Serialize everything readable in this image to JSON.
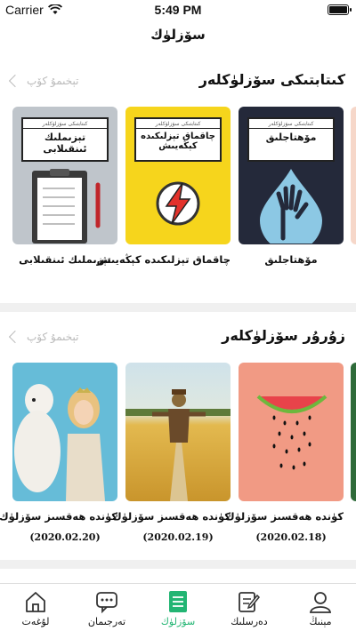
{
  "status": {
    "carrier": "Carrier",
    "time": "5:49 PM"
  },
  "nav": {
    "title": "سۆزلۈك"
  },
  "sections": [
    {
      "title": "كىتابتىكى سۆزلۈكلەر",
      "more": "تېخىمۇ كۆپ",
      "items": [
        {
          "title": "مۆھتاجلىق",
          "cover_title": "مۆھتاجلىق",
          "cover_small": "كىتابتىكى سۆزلۈكلەر"
        },
        {
          "title": "چاقماق تېزلىكىدە كېڭەيىش",
          "cover_title": "چاقماق تېزلىكىدە كېڭەيىش",
          "cover_small": "كىتابتىكى سۆزلۈكلەر"
        },
        {
          "title": "تېزىملىك ئىنقىلابى",
          "cover_title": "تېزىملىك ئىنقىلابى",
          "cover_small": "كىتابتىكى سۆزلۈكلەر"
        }
      ]
    },
    {
      "title": "زۇرۇر سۆزلۈكلەر",
      "more": "تېخىمۇ كۆپ",
      "items": [
        {
          "title": "كۈندە ھەقسىز سۆزلۈك",
          "date": "(2020.02.18)"
        },
        {
          "title": "كۈندە ھەقسىز سۆزلۈك",
          "date": "(2020.02.19)"
        },
        {
          "title": "كۈندە ھەقسىز سۆزلۈك",
          "date": "(2020.02.20)"
        }
      ]
    }
  ],
  "tabs": [
    {
      "label": "مېنىڭ",
      "icon": "person-icon"
    },
    {
      "label": "دەرسلىك",
      "icon": "pencil-paper-icon"
    },
    {
      "label": "سۆزلۈك",
      "icon": "vocabulary-list-icon",
      "active": true
    },
    {
      "label": "تەرجىمان",
      "icon": "chat-bubble-icon"
    },
    {
      "label": "لۇغەت",
      "icon": "home-icon"
    }
  ],
  "colors": {
    "accent": "#22b573",
    "muted": "#bbbbbb"
  }
}
